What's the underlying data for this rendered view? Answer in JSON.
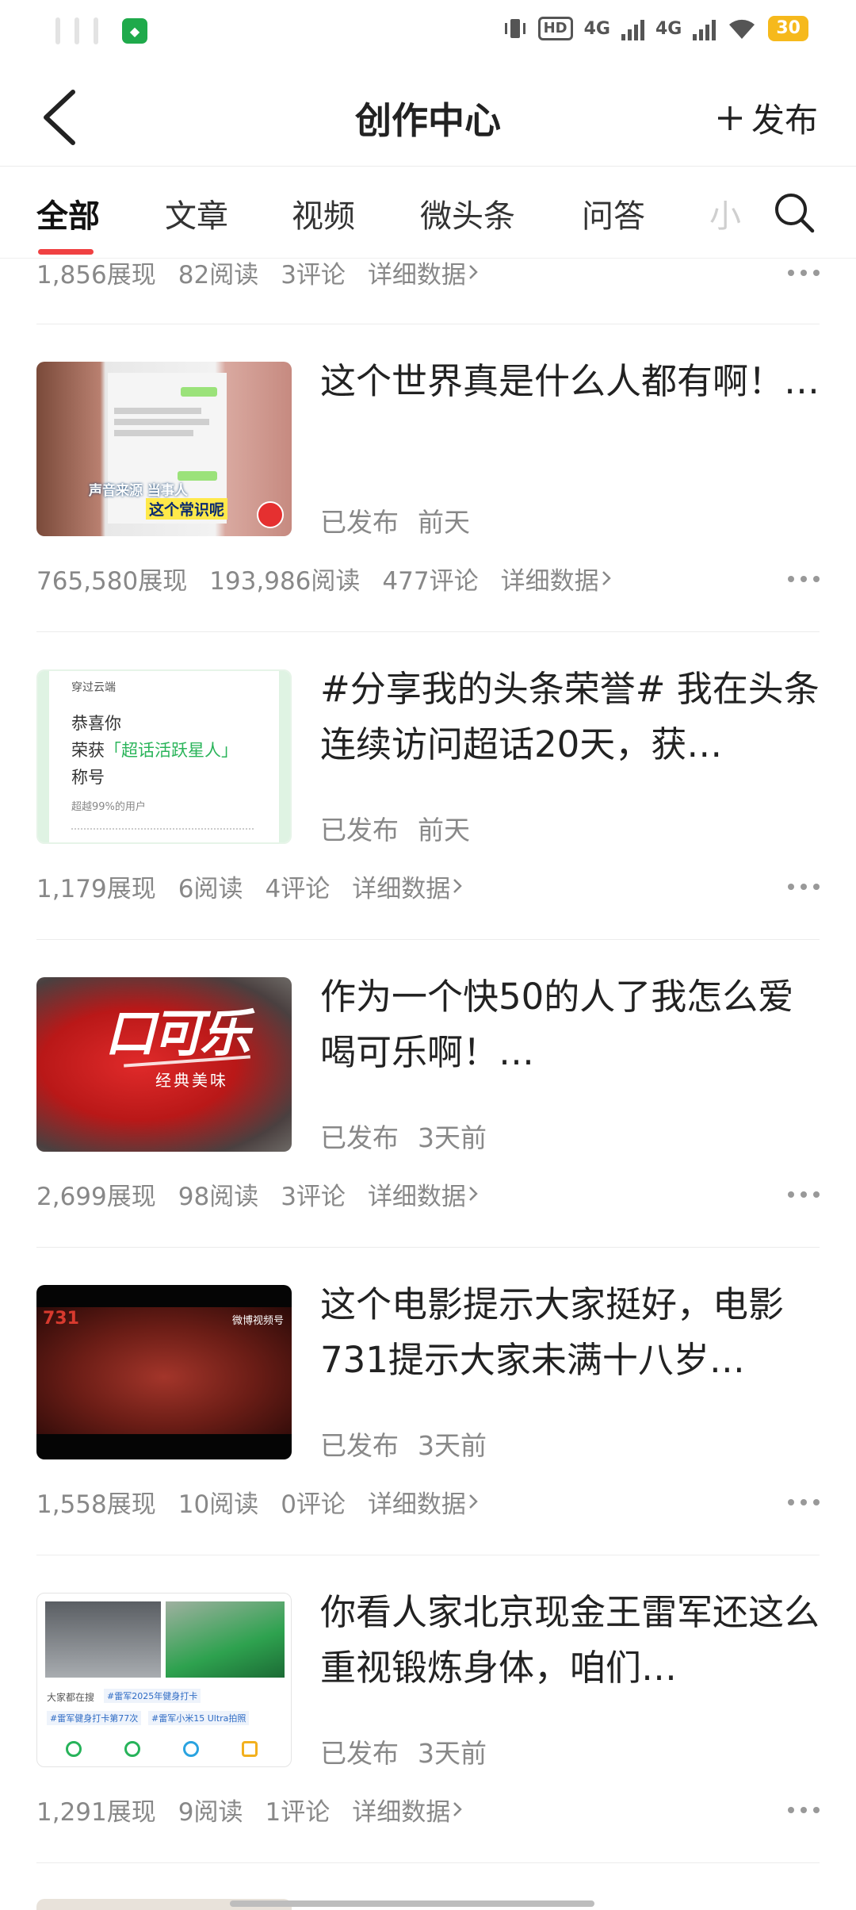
{
  "statusbar": {
    "hd_label": "HD",
    "net1": "4G",
    "net2": "4G",
    "battery": "30"
  },
  "header": {
    "title": "创作中心",
    "publish_label": "发布"
  },
  "tabs": [
    "全部",
    "文章",
    "视频",
    "微头条",
    "问答",
    "小"
  ],
  "top_stats": {
    "impressions": "1,856展现",
    "reads": "82阅读",
    "comments": "3评论",
    "detail": "详细数据"
  },
  "items": [
    {
      "title": "这个世界真是什么人都有啊！…",
      "status": "已发布",
      "time": "前天",
      "impressions": "765,580展现",
      "reads": "193,986阅读",
      "comments": "477评论",
      "detail": "详细数据",
      "thumb_caption1": "声音来源 当事人",
      "thumb_caption2": "这个常识呢"
    },
    {
      "title": "#分享我的头条荣誉# 我在头条连续访问超话20天，获…",
      "status": "已发布",
      "time": "前天",
      "impressions": "1,179展现",
      "reads": "6阅读",
      "comments": "4评论",
      "detail": "详细数据",
      "thumb_top": "穿过云端",
      "thumb_line1": "恭喜你",
      "thumb_line2_prefix": "荣获",
      "thumb_line2_highlight": "「超话活跃星人」",
      "thumb_line3": "称号",
      "thumb_line4": "超越99%的用户"
    },
    {
      "title": "作为一个快50的人了我怎么爱喝可乐啊！…",
      "status": "已发布",
      "time": "3天前",
      "impressions": "2,699展现",
      "reads": "98阅读",
      "comments": "3评论",
      "detail": "详细数据",
      "thumb_brand": "口可乐",
      "thumb_sub": "经典美味"
    },
    {
      "title": "这个电影提示大家挺好，电影731提示大家未满十八岁…",
      "status": "已发布",
      "time": "3天前",
      "impressions": "1,558展现",
      "reads": "10阅读",
      "comments": "0评论",
      "detail": "详细数据",
      "thumb_tag": "731",
      "thumb_logo": "微博视频号"
    },
    {
      "title": "你看人家北京现金王雷军还这么重视锻炼身体，咱们…",
      "status": "已发布",
      "time": "3天前",
      "impressions": "1,291展现",
      "reads": "9阅读",
      "comments": "1评论",
      "detail": "详细数据",
      "thumb_search": "大家都在搜",
      "thumb_tag1": "#雷军2025年健身打卡",
      "thumb_tag2": "#雷军健身打卡第77次",
      "thumb_tag3": "#雷军小米15 Ultra拍照"
    }
  ],
  "colors": {
    "accent": "#f04142",
    "highlight_green": "#2ab45a",
    "meta_gray": "#888888"
  }
}
